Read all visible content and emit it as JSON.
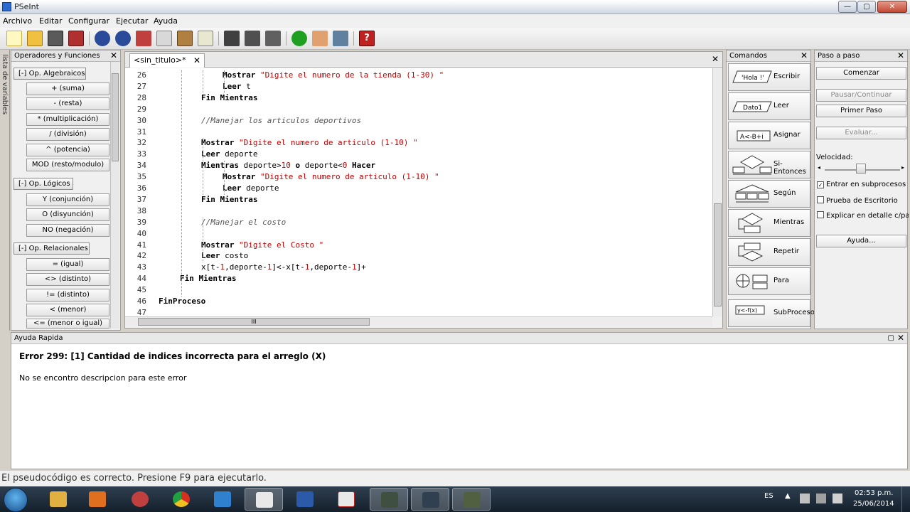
{
  "window": {
    "title": "PSeInt"
  },
  "menu": [
    "Archivo",
    "Editar",
    "Configurar",
    "Ejecutar",
    "Ayuda"
  ],
  "left_panel": {
    "vertical_tab": "lista de variables",
    "title": "Operadores y Funciones",
    "groups": [
      {
        "label": "[-]  Op. Algebraicos",
        "items": [
          "+ (suma)",
          "- (resta)",
          "* (multiplicación)",
          "/ (división)",
          "^ (potencia)",
          "MOD (resto/modulo)"
        ]
      },
      {
        "label": "[-]  Op. Lógicos",
        "items": [
          "Y (conjunción)",
          "O (disyunción)",
          "NO (negación)"
        ]
      },
      {
        "label": "[-]  Op. Relacionales",
        "items": [
          "= (igual)",
          "<> (distinto)",
          "!= (distinto)",
          "< (menor)",
          "<= (menor o igual)"
        ]
      }
    ]
  },
  "editor": {
    "tab_label": "<sin_titulo>*",
    "lines": [
      {
        "n": "26",
        "code": [
          [
            "kw",
            "Mostrar "
          ],
          [
            "st",
            "\"Digite el numero de la tienda (1-30) \""
          ]
        ]
      },
      {
        "n": "27",
        "code": [
          [
            "kw",
            "Leer "
          ],
          [
            "tx",
            "t"
          ]
        ]
      },
      {
        "n": "28",
        "code": [
          [
            "kw",
            "Fin Mientras"
          ]
        ]
      },
      {
        "n": "29",
        "code": []
      },
      {
        "n": "30",
        "code": [
          [
            "cm",
            "//Manejar los articulos deportivos"
          ]
        ]
      },
      {
        "n": "31",
        "code": []
      },
      {
        "n": "32",
        "code": [
          [
            "kw",
            "Mostrar "
          ],
          [
            "st",
            "\"Digite el numero de articulo (1-10) \""
          ]
        ]
      },
      {
        "n": "33",
        "code": [
          [
            "kw",
            "Leer "
          ],
          [
            "tx",
            "deporte"
          ]
        ]
      },
      {
        "n": "34",
        "code": [
          [
            "kw",
            "Mientras "
          ],
          [
            "tx",
            "deporte>"
          ],
          [
            "nm",
            "10"
          ],
          [
            "kw",
            " o "
          ],
          [
            "tx",
            "deporte<"
          ],
          [
            "nm",
            "0"
          ],
          [
            "kw",
            " Hacer"
          ]
        ]
      },
      {
        "n": "35",
        "code": [
          [
            "kw",
            "Mostrar "
          ],
          [
            "st",
            "\"Digite el numero de articulo (1-10) \""
          ]
        ]
      },
      {
        "n": "36",
        "code": [
          [
            "kw",
            "Leer "
          ],
          [
            "tx",
            "deporte"
          ]
        ]
      },
      {
        "n": "37",
        "code": [
          [
            "kw",
            "Fin Mientras"
          ]
        ]
      },
      {
        "n": "38",
        "code": []
      },
      {
        "n": "39",
        "code": [
          [
            "cm",
            "//Manejar el costo"
          ]
        ]
      },
      {
        "n": "40",
        "code": []
      },
      {
        "n": "41",
        "code": [
          [
            "kw",
            "Mostrar "
          ],
          [
            "st",
            "\"Digite el Costo \""
          ]
        ]
      },
      {
        "n": "42",
        "code": [
          [
            "kw",
            "Leer "
          ],
          [
            "tx",
            "costo"
          ]
        ]
      },
      {
        "n": "43",
        "code": [
          [
            "tx",
            "x[t-"
          ],
          [
            "nm",
            "1"
          ],
          [
            "tx",
            ",deporte-"
          ],
          [
            "nm",
            "1"
          ],
          [
            "tx",
            "]<-x[t-"
          ],
          [
            "nm",
            "1"
          ],
          [
            "tx",
            ",deporte-"
          ],
          [
            "nm",
            "1"
          ],
          [
            "tx",
            "]+"
          ]
        ]
      },
      {
        "n": "44",
        "code": [
          [
            "kw",
            "Fin Mientras"
          ]
        ]
      },
      {
        "n": "45",
        "code": []
      },
      {
        "n": "46",
        "code": [
          [
            "kw",
            "FinProceso"
          ]
        ]
      },
      {
        "n": "47",
        "code": []
      }
    ]
  },
  "commands": {
    "title": "Comandos",
    "items": [
      "Escribir",
      "Leer",
      "Asignar",
      "Si-Entonces",
      "Según",
      "Mientras",
      "Repetir",
      "Para",
      "SubProceso"
    ],
    "icon_text": {
      "escribir": "'Hola !'",
      "leer": "Dato1",
      "asignar": "A<-B+i",
      "subproceso": "y<-f(x)"
    }
  },
  "step": {
    "title": "Paso a paso",
    "start": "Comenzar",
    "pause": "Pausar/Continuar",
    "first_step": "Primer Paso",
    "evaluate": "Evaluar...",
    "speed_label": "Velocidad:",
    "speed_level": 0.55,
    "check_subprocesos": "Entrar en subprocesos",
    "check_prueba": "Prueba de Escritorio",
    "check_explicar": "Explicar en detalle c/paso",
    "help": "Ayuda..."
  },
  "help": {
    "title": "Ayuda Rapida",
    "error": "Error 299: [1] Cantidad de indices incorrecta para el arreglo (X)",
    "description": "No se encontro descripcion para este error"
  },
  "status": "El pseudocódigo es correcto. Presione F9 para ejecutarlo.",
  "tray": {
    "lang": "ES",
    "time": "02:53 p.m.",
    "date": "25/06/2014"
  },
  "colors": {
    "keyword": "#000000",
    "string": "#c00000",
    "comment": "#555555",
    "taskbar": "#1f2d3b"
  }
}
